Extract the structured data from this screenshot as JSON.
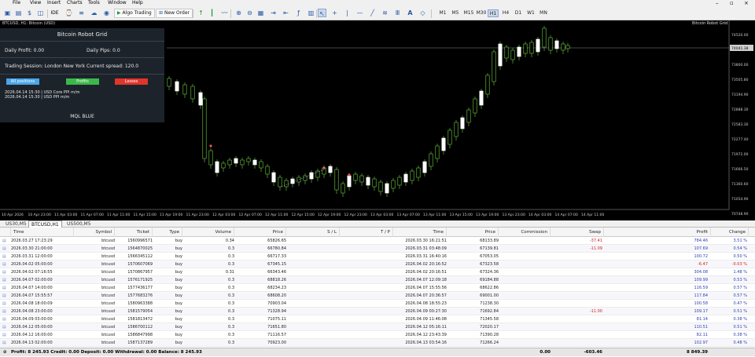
{
  "menu": {
    "items": [
      "File",
      "View",
      "Insert",
      "Charts",
      "Tools",
      "Window",
      "Help"
    ]
  },
  "toolbar": {
    "algo_trading": "Algo Trading",
    "new_order": "New Order",
    "timeframes": [
      "M1",
      "M5",
      "M15",
      "M30",
      "H1",
      "H4",
      "D1",
      "W1",
      "MN"
    ],
    "active_tf": "H1"
  },
  "chart": {
    "ticker": "BTCUSD, H1: Bitcoin (USD)",
    "robot_label": "Bitcoin Robot Grid",
    "price_labels": [
      "74520.00",
      "74104.40",
      "73800.00",
      "73505.80",
      "73194.90",
      "72888.30",
      "72583.30",
      "72277.40",
      "71972.00",
      "71666.50",
      "71360.60",
      "71054.90",
      "70748.90"
    ],
    "current_price": "74041.38",
    "time_labels": [
      "10 Apr 2026",
      "10 Apr 23:00",
      "11 Apr 03:00",
      "11 Apr 07:00",
      "11 Apr 11:00",
      "11 Apr 15:00",
      "11 Apr 19:00",
      "11 Apr 23:00",
      "12 Apr 03:00",
      "12 Apr 07:00",
      "12 Apr 11:00",
      "12 Apr 15:00",
      "12 Apr 19:00",
      "12 Apr 23:00",
      "13 Apr 03:00",
      "13 Apr 07:00",
      "13 Apr 11:00",
      "13 Apr 15:00",
      "13 Apr 19:00",
      "13 Apr 23:00",
      "14 Apr 03:00",
      "14 Apr 07:00",
      "14 Apr 11:00"
    ]
  },
  "robot": {
    "title": "Bitcoin Robot Grid",
    "daily_profit": "Daily Profit: 0.00",
    "daily_pips": "Daily Pips:  0.0",
    "session": "Trading Session: London New York  Current spread:  120.0",
    "btn_all": "All positions",
    "btn_profits": "Profits",
    "btn_losses": "Losses",
    "news": [
      "2026.04.14 15:30 | USD  Core PPI m/m",
      "2026.04.14 15:30 | USD  PPI m/m"
    ],
    "footer": "MQL BLUE"
  },
  "tabs": [
    "US30,M5",
    "BTCUSD,H1",
    "US500,M5"
  ],
  "table": {
    "headers": [
      "Time",
      "Symbol",
      "Ticket",
      "Type",
      "Volume",
      "Price",
      "S / L",
      "T / P",
      "Time",
      "Price",
      "Commission",
      "Swap",
      "Profit",
      "Change"
    ],
    "rows": [
      [
        "2026.03.27 17:23:29",
        "btcusd",
        "1560996571",
        "buy",
        "0.34",
        "65826.65",
        "",
        "",
        "2026.03.30 16:21:51",
        "68133.89",
        "",
        "-37.41",
        "784.46",
        "3.51 %"
      ],
      [
        "2026.03.30 21:00:00",
        "btcusd",
        "1564870025",
        "buy",
        "0.3",
        "66780.84",
        "",
        "",
        "2026.03.31 03:48:09",
        "67139.81",
        "",
        "-11.09",
        "107.69",
        "0.54 %"
      ],
      [
        "2026.03.31 12:00:00",
        "btcusd",
        "1566345112",
        "buy",
        "0.3",
        "66717.33",
        "",
        "",
        "2026.03.31 16:40:16",
        "67053.05",
        "",
        "",
        "100.72",
        "0.50 %"
      ],
      [
        "2026.04.02 05:00:00",
        "btcusd",
        "1570607069",
        "buy",
        "0.3",
        "67345.15",
        "",
        "",
        "2026.04.02 20:16:52",
        "67323.58",
        "",
        "",
        "-6.47",
        "-0.03 %"
      ],
      [
        "2026.04.02 07:16:55",
        "btcusd",
        "1570867957",
        "buy",
        "0.31",
        "66343.46",
        "",
        "",
        "2026.04.02 20:16:51",
        "67324.36",
        "",
        "",
        "304.08",
        "1.48 %"
      ],
      [
        "2026.04.07 02:00:00",
        "btcusd",
        "1576171925",
        "buy",
        "0.3",
        "68818.26",
        "",
        "",
        "2026.04.07 12:09:18",
        "69184.88",
        "",
        "",
        "109.99",
        "0.53 %"
      ],
      [
        "2026.04.07 14:00:00",
        "btcusd",
        "1577436177",
        "buy",
        "0.3",
        "68234.23",
        "",
        "",
        "2026.04.07 15:55:56",
        "68622.86",
        "",
        "",
        "116.59",
        "0.57 %"
      ],
      [
        "2026.04.07 15:55:57",
        "btcusd",
        "1577683276",
        "buy",
        "0.3",
        "68608.20",
        "",
        "",
        "2026.04.07 20:36:57",
        "69001.00",
        "",
        "",
        "117.84",
        "0.57 %"
      ],
      [
        "2026.04.08 18:00:09",
        "btcusd",
        "1580963388",
        "buy",
        "0.3",
        "70903.04",
        "",
        "",
        "2026.04.08 18:55:23",
        "71238.30",
        "",
        "",
        "100.58",
        "0.47 %"
      ],
      [
        "2026.04.08 23:00:00",
        "btcusd",
        "1581579054",
        "buy",
        "0.3",
        "71328.94",
        "",
        "",
        "2026.04.09 00:27:30",
        "71692.84",
        "",
        "-11.00",
        "109.17",
        "0.51 %"
      ],
      [
        "2026.04.09 03:00:00",
        "btcusd",
        "1581813472",
        "buy",
        "0.3",
        "71075.11",
        "",
        "",
        "2026.04.09 11:46:08",
        "71345.58",
        "",
        "",
        "81.14",
        "0.38 %"
      ],
      [
        "2026.04.12 05:00:00",
        "btcusd",
        "1586700112",
        "buy",
        "0.3",
        "71651.80",
        "",
        "",
        "2026.04.12 05:16:11",
        "72020.17",
        "",
        "",
        "110.51",
        "0.51 %"
      ],
      [
        "2026.04.12 16:00:00",
        "btcusd",
        "1586847998",
        "buy",
        "0.3",
        "71116.57",
        "",
        "",
        "2026.04.12 23:43:39",
        "71390.28",
        "",
        "",
        "82.11",
        "0.38 %"
      ],
      [
        "2026.04.13 02:00:00",
        "btcusd",
        "1587137289",
        "buy",
        "0.3",
        "70923.00",
        "",
        "",
        "2026.04.13 03:54:16",
        "71266.24",
        "",
        "",
        "102.97",
        "0.48 %"
      ]
    ]
  },
  "summary": {
    "text": "Profit: 8 245.93  Credit: 0.00  Deposit: 0.00  Withdrawal: 0.00  Balance: 8 245.93",
    "commission": "0.00",
    "swap": "-603.46",
    "profit": "8 849.39"
  }
}
